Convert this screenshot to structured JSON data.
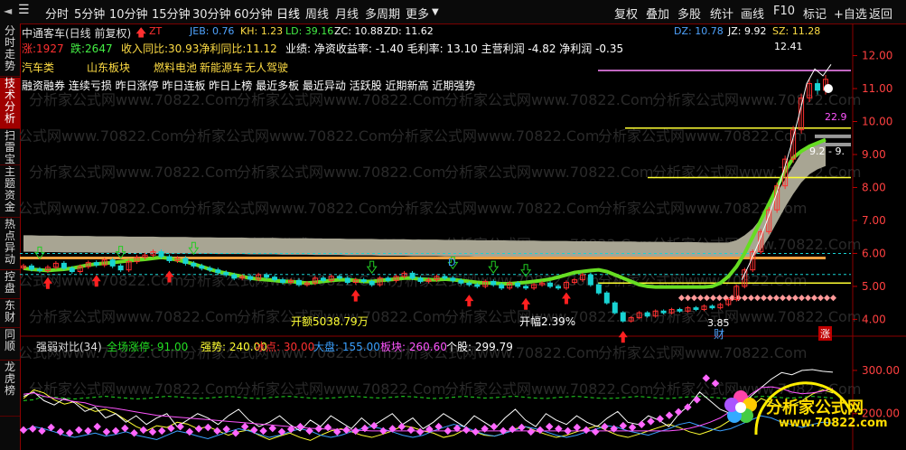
{
  "toolbar": {
    "periods": [
      "分时",
      "5分钟",
      "10分钟",
      "15分钟",
      "30分钟",
      "60分钟",
      "日线",
      "周线",
      "月线",
      "多周期",
      "更多"
    ],
    "active_period": "日线",
    "right_buttons": [
      "复权",
      "叠加",
      "多股",
      "统计",
      "画线",
      "F10",
      "标记",
      "+自选",
      "返回"
    ]
  },
  "sidebar": [
    "分时走势",
    "技术分析",
    "扫雷宝",
    "主题资金",
    "热点异动",
    "控盘",
    "东财",
    "同顺",
    "龙虎榜"
  ],
  "sidebar_active": "技术分析",
  "header": {
    "title": "中通客车(日线 前复权)",
    "zt": "ZT",
    "ind": {
      "jeb": "JEB: 0.76",
      "kh": "KH: 1.23",
      "ld": "LD: 39.16",
      "zc": "ZC: 10.88",
      "zd": "ZD: 11.62"
    },
    "right": {
      "dz": "DZ: 10.78",
      "jz": "JZ: 9.92",
      "sz": "SZ: 11.28"
    }
  },
  "info": {
    "zhang": "涨:1927",
    "die": "跌:2647",
    "growth": "收入同比:30.93净利同比:11.12",
    "perf": "业绩: 净资收益率: -1.40 毛利率: 13.10 主营利润 -4.82 净利润 -0.35",
    "concepts": [
      "汽车类",
      "山东板块",
      "燃料电池",
      "新能源车",
      "无人驾驶"
    ],
    "tags": "融资融券 连续亏损 昨日涨停 昨日连板 昨日上榜 最近多板 最近异动 活跃股 近期新高 近期强势"
  },
  "watermark": "分析家公式网www.70822.Com",
  "annotations": {
    "high": "12.41",
    "low": "3.85",
    "turnover": "开额5038.79万",
    "amplitude": "开幅2.39%",
    "pct": "22.9",
    "ma_label": "9.2 - 9.",
    "cai": "财",
    "zhang_badge": "涨",
    "d_marker": "D"
  },
  "colors": {
    "up": "#ff3030",
    "down": "#19d3d3",
    "ma_green": "#66dd22",
    "ma_gray": "#a8a593",
    "orange": "#f0a040",
    "yellow": "#ffff33",
    "pink": "#ff88ff",
    "arrow_green": "#22cc22"
  },
  "indicator": {
    "name": "强弱对比(34)",
    "items": {
      "whole": "全场涨停: 91.00",
      "strong": "强势: 240.00",
      "ice": "冰点: 30.00",
      "market": "大盘: 155.00",
      "sector": "板块: 260.60",
      "stock": "个股: 299.79"
    }
  },
  "logo": {
    "name": "分析家公式网",
    "url": "www.70822.com"
  },
  "chart_data": [
    {
      "type": "candlestick",
      "title": "中通客车(日线 前复权)",
      "y_ticks": [
        4.0,
        5.0,
        6.0,
        7.0,
        8.0,
        9.0,
        10.0,
        11.0,
        12.0
      ],
      "ylim": [
        3.6,
        12.7
      ],
      "close": [
        5.62,
        5.52,
        5.48,
        5.58,
        5.7,
        5.55,
        5.45,
        5.6,
        5.72,
        5.65,
        5.8,
        5.62,
        5.5,
        5.75,
        5.88,
        5.95,
        6.05,
        5.9,
        5.78,
        5.85,
        5.7,
        5.62,
        5.55,
        5.5,
        5.42,
        5.35,
        5.25,
        5.3,
        5.22,
        5.35,
        5.28,
        5.2,
        5.12,
        5.18,
        5.05,
        5.1,
        5.25,
        5.18,
        5.3,
        5.25,
        5.12,
        5.2,
        5.15,
        5.05,
        5.25,
        5.18,
        5.3,
        5.4,
        5.25,
        5.15,
        5.2,
        5.3,
        5.25,
        5.18,
        5.1,
        5.05,
        5.0,
        5.15,
        5.05,
        4.95,
        5.1,
        5.0,
        4.95,
        5.05,
        5.1,
        5.0,
        4.95,
        5.12,
        5.2,
        5.35,
        5.05,
        4.8,
        4.5,
        4.2,
        3.95,
        4.05,
        4.2,
        4.1,
        4.25,
        4.2,
        4.3,
        4.25,
        4.35,
        4.3,
        4.4,
        4.35,
        4.45,
        4.6,
        5.0,
        5.5,
        6.05,
        6.66,
        7.32,
        8.05,
        8.86,
        9.75,
        10.72,
        11.15,
        10.95,
        11.28
      ],
      "ma_green": [
        5.55,
        5.52,
        5.5,
        5.48,
        5.5,
        5.52,
        5.55,
        5.6,
        5.65,
        5.68,
        5.7,
        5.72,
        5.75,
        5.78,
        5.8,
        5.82,
        5.85,
        5.88,
        5.85,
        5.8,
        5.75,
        5.68,
        5.6,
        5.52,
        5.45,
        5.4,
        5.35,
        5.3,
        5.25,
        5.22,
        5.2,
        5.18,
        5.15,
        5.15,
        5.12,
        5.1,
        5.12,
        5.15,
        5.18,
        5.2,
        5.2,
        5.18,
        5.15,
        5.15,
        5.18,
        5.2,
        5.22,
        5.25,
        5.25,
        5.22,
        5.2,
        5.2,
        5.22,
        5.2,
        5.18,
        5.15,
        5.12,
        5.1,
        5.1,
        5.08,
        5.08,
        5.1,
        5.12,
        5.15,
        5.18,
        5.22,
        5.28,
        5.35,
        5.42,
        5.45,
        5.48,
        5.5,
        5.45,
        5.35,
        5.25,
        5.15,
        5.05,
        5.0,
        4.98,
        4.98,
        4.98,
        4.98,
        4.98,
        4.98,
        4.98,
        5.0,
        5.1,
        5.3,
        5.6,
        6.0,
        6.5,
        7.0,
        7.5,
        8.0,
        8.5,
        8.9,
        9.1,
        9.25,
        9.35,
        9.45
      ],
      "ma_gray_upper": [
        6.55,
        6.55,
        6.54,
        6.54,
        6.54,
        6.53,
        6.53,
        6.53,
        6.53,
        6.52,
        6.52,
        6.52,
        6.52,
        6.51,
        6.51,
        6.51,
        6.51,
        6.5,
        6.5,
        6.5,
        6.5,
        6.49,
        6.49,
        6.49,
        6.48,
        6.48,
        6.48,
        6.48,
        6.47,
        6.47,
        6.47,
        6.47,
        6.46,
        6.46,
        6.46,
        6.46,
        6.45,
        6.45,
        6.45,
        6.45,
        6.44,
        6.44,
        6.44,
        6.44,
        6.43,
        6.43,
        6.43,
        6.43,
        6.42,
        6.42,
        6.42,
        6.42,
        6.41,
        6.41,
        6.41,
        6.41,
        6.4,
        6.4,
        6.4,
        6.4,
        6.39,
        6.39,
        6.39,
        6.39,
        6.38,
        6.38,
        6.38,
        6.38,
        6.37,
        6.37,
        6.37,
        6.37,
        6.36,
        6.36,
        6.36,
        6.36,
        6.35,
        6.35,
        6.35,
        6.35,
        6.34,
        6.34,
        6.34,
        6.34,
        6.33,
        6.33,
        6.33,
        6.33,
        6.4,
        6.55,
        6.75,
        7.05,
        7.45,
        7.85,
        8.25,
        8.65,
        9.05,
        9.25,
        9.35,
        9.45
      ],
      "ma_gray_lower": [
        6.05,
        6.05,
        6.04,
        6.04,
        6.04,
        6.03,
        6.03,
        6.03,
        6.03,
        6.02,
        6.02,
        6.02,
        6.02,
        6.01,
        6.01,
        6.01,
        6.01,
        6.0,
        6.0,
        6.0,
        6.0,
        5.99,
        5.99,
        5.99,
        5.98,
        5.98,
        5.98,
        5.98,
        5.97,
        5.97,
        5.97,
        5.97,
        5.96,
        5.96,
        5.96,
        5.96,
        5.95,
        5.95,
        5.95,
        5.95,
        5.94,
        5.94,
        5.94,
        5.94,
        5.93,
        5.93,
        5.93,
        5.93,
        5.92,
        5.92,
        5.92,
        5.92,
        5.91,
        5.91,
        5.91,
        5.91,
        5.9,
        5.9,
        5.9,
        5.9,
        5.89,
        5.89,
        5.89,
        5.89,
        5.88,
        5.88,
        5.88,
        5.88,
        5.87,
        5.87,
        5.87,
        5.87,
        5.86,
        5.86,
        5.86,
        5.86,
        5.85,
        5.85,
        5.85,
        5.85,
        5.84,
        5.84,
        5.84,
        5.84,
        5.83,
        5.83,
        5.83,
        5.83,
        5.83,
        5.85,
        5.9,
        6.1,
        6.5,
        6.95,
        7.4,
        7.8,
        8.15,
        8.4,
        8.55,
        8.65
      ],
      "orange_level": 5.86,
      "yellow_levels": [
        9.8,
        8.3,
        5.1
      ],
      "cyan_dashed_levels": [
        6.0,
        5.36
      ],
      "magenta_level": 11.55,
      "pink_level": 4.65,
      "gray_levels": [
        9.55,
        9.3
      ]
    },
    {
      "type": "line",
      "title": "强弱对比(34)",
      "y_ticks": [
        200.0,
        300.0
      ],
      "ylim": [
        120,
        350
      ],
      "series": [
        {
          "name": "全场涨停",
          "color": "#22dd22",
          "values": [
            230,
            232,
            240,
            238,
            236,
            234,
            236,
            238,
            240,
            238,
            236,
            234,
            235,
            238,
            240,
            239,
            237,
            235,
            236,
            238,
            240,
            238,
            236,
            235,
            237,
            239,
            240,
            238,
            236,
            235,
            236,
            238,
            240,
            239,
            237,
            236,
            238,
            240,
            239,
            237,
            235,
            236,
            238,
            240,
            238,
            236,
            237,
            239,
            240,
            238,
            236,
            235,
            237,
            239,
            240,
            238,
            236,
            235,
            236,
            238,
            240,
            238,
            236,
            235,
            237,
            239,
            240,
            238,
            236,
            235,
            236,
            238,
            240,
            239,
            237,
            236,
            238,
            240,
            238,
            236
          ]
        },
        {
          "name": "强势",
          "color": "#ffff33",
          "values": [
            235,
            255,
            248,
            232,
            222,
            228,
            215,
            205,
            210,
            200,
            185,
            170,
            160,
            172,
            168,
            180,
            176,
            165,
            170,
            160,
            150,
            158,
            162,
            150,
            140,
            148,
            155,
            145,
            138,
            150,
            160,
            165,
            158,
            150,
            145,
            152,
            160,
            172,
            168,
            160,
            155,
            145,
            150,
            162,
            158,
            150,
            148,
            155,
            165,
            170,
            160,
            152,
            145,
            150,
            158,
            165,
            172,
            160,
            150,
            145,
            152,
            160,
            168,
            175,
            168,
            158,
            152,
            160,
            170,
            185,
            200,
            215,
            235,
            225,
            215,
            220,
            230,
            245,
            255,
            248
          ]
        },
        {
          "name": "大盘",
          "color": "#3aa0ff",
          "values": [
            160,
            170,
            165,
            158,
            150,
            145,
            150,
            155,
            148,
            152,
            158,
            150,
            145,
            140,
            150,
            160,
            155,
            148,
            142,
            150,
            158,
            165,
            160,
            152,
            145,
            150,
            158,
            165,
            160,
            150,
            145,
            150,
            158,
            165,
            170,
            165,
            158,
            150,
            145,
            150,
            160,
            168,
            175,
            170,
            160,
            152,
            148,
            155,
            162,
            170,
            165,
            158,
            150,
            145,
            150,
            158,
            165,
            172,
            168,
            160,
            155,
            150,
            158,
            165,
            175,
            180,
            172,
            165,
            160,
            165,
            175,
            185,
            195,
            190,
            180,
            175,
            168,
            175,
            180,
            178
          ]
        },
        {
          "name": "个股",
          "color": "#ffffff",
          "values": [
            240,
            250,
            230,
            220,
            235,
            225,
            205,
            215,
            190,
            200,
            180,
            195,
            175,
            190,
            200,
            170,
            185,
            200,
            190,
            175,
            195,
            210,
            185,
            170,
            180,
            195,
            175,
            160,
            185,
            170,
            195,
            180,
            165,
            190,
            170,
            185,
            200,
            175,
            190,
            165,
            180,
            200,
            185,
            170,
            195,
            180,
            165,
            190,
            210,
            185,
            170,
            200,
            185,
            175,
            195,
            180,
            170,
            190,
            205,
            180,
            175,
            195,
            185,
            170,
            200,
            220,
            250,
            230,
            210,
            200,
            215,
            240,
            260,
            280,
            295,
            290,
            300,
            302,
            298,
            296
          ]
        },
        {
          "name": "板块",
          "color": "#ff55ff",
          "values": [
            245,
            248,
            240,
            236,
            232,
            228,
            225,
            218,
            215,
            212,
            208,
            204,
            200,
            196,
            194,
            192,
            190,
            188,
            186,
            184,
            182,
            180,
            178,
            176,
            174,
            172,
            170,
            168,
            166,
            165,
            164,
            163,
            162,
            161,
            160,
            160,
            160,
            160,
            160,
            160,
            160,
            160,
            160,
            160,
            160,
            160,
            160,
            160,
            160,
            160,
            160,
            160,
            160,
            160,
            160,
            160,
            160,
            160,
            160,
            160,
            160,
            160,
            160,
            160,
            162,
            166,
            172,
            180,
            190,
            205,
            225,
            245,
            260,
            262,
            258,
            250,
            246,
            248,
            252,
            258
          ]
        }
      ],
      "marker_values": [
        162,
        165,
        160,
        168,
        158,
        155,
        162,
        160,
        170,
        158,
        160,
        166,
        155,
        162,
        158,
        160,
        166,
        170,
        158,
        165,
        168,
        160,
        164,
        155,
        170,
        162,
        160,
        166,
        158,
        164,
        170,
        160,
        165,
        168,
        158,
        162,
        160,
        166,
        172,
        160,
        165,
        170,
        162,
        158,
        164,
        170,
        160,
        166,
        162,
        158,
        165,
        170,
        160,
        164,
        168,
        158,
        162,
        170,
        165,
        160,
        168,
        162,
        158,
        170,
        165,
        172,
        168,
        175,
        182,
        188,
        196,
        204,
        215,
        232,
        282,
        270
      ]
    }
  ]
}
